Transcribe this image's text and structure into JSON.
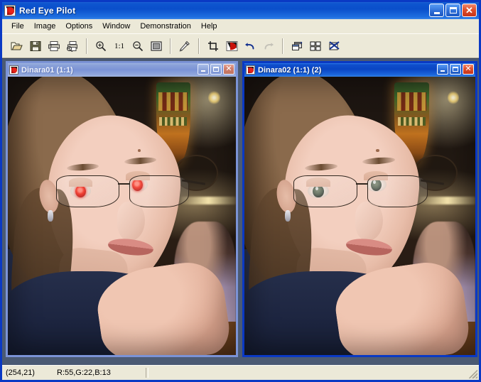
{
  "window": {
    "title": "Red Eye Pilot",
    "icon": "red-eye-logo-icon",
    "caption_buttons": {
      "minimize": "Minimize",
      "maximize": "Maximize",
      "close": "Close"
    }
  },
  "menubar": {
    "items": [
      {
        "label": "File"
      },
      {
        "label": "Image"
      },
      {
        "label": "Options"
      },
      {
        "label": "Window"
      },
      {
        "label": "Demonstration"
      },
      {
        "label": "Help"
      }
    ]
  },
  "toolbar": {
    "buttons": [
      {
        "name": "open-icon",
        "tooltip": "Open"
      },
      {
        "name": "save-icon",
        "tooltip": "Save"
      },
      {
        "name": "print-icon",
        "tooltip": "Print"
      },
      {
        "name": "print-preview-icon",
        "tooltip": "Print Preview"
      },
      {
        "name": "zoom-in-icon",
        "tooltip": "Zoom In"
      },
      {
        "name": "zoom-actual-size-label",
        "tooltip": "Actual Size",
        "label": "1:1"
      },
      {
        "name": "zoom-out-icon",
        "tooltip": "Zoom Out"
      },
      {
        "name": "fit-to-window-icon",
        "tooltip": "Fit To Window"
      },
      {
        "name": "eyedropper-icon",
        "tooltip": "Color Picker"
      },
      {
        "name": "crop-icon",
        "tooltip": "Crop"
      },
      {
        "name": "red-eye-removal-icon",
        "tooltip": "Remove Red Eye"
      },
      {
        "name": "undo-icon",
        "tooltip": "Undo",
        "enabled": true
      },
      {
        "name": "redo-icon",
        "tooltip": "Redo",
        "enabled": false
      },
      {
        "name": "cascade-windows-icon",
        "tooltip": "Cascade"
      },
      {
        "name": "tile-windows-icon",
        "tooltip": "Tile"
      },
      {
        "name": "close-all-windows-icon",
        "tooltip": "Close All"
      }
    ]
  },
  "mdi": {
    "children": [
      {
        "id": "dinara01",
        "title": "Dinara01 (1:1)",
        "active": false,
        "image": {
          "subject": "young woman with glasses resting chin on hands",
          "state": "red-eye-uncorrected",
          "eye_color": "#f02010"
        }
      },
      {
        "id": "dinara02",
        "title": "Dinara02 (1:1) (2)",
        "active": true,
        "image": {
          "subject": "young woman with glasses resting chin on hands",
          "state": "red-eye-corrected",
          "eye_color": "#4e5a49"
        }
      }
    ]
  },
  "statusbar": {
    "coordinates": "(254,21)",
    "color_values": "R:55,G:22,B:13",
    "extra_panel": ""
  },
  "colors": {
    "active_title": "#0a45c4",
    "inactive_title": "#7b93d6",
    "face_background": "#ece9d8",
    "mdi_background": "#4b5a73",
    "close_button": "#c5331a"
  }
}
